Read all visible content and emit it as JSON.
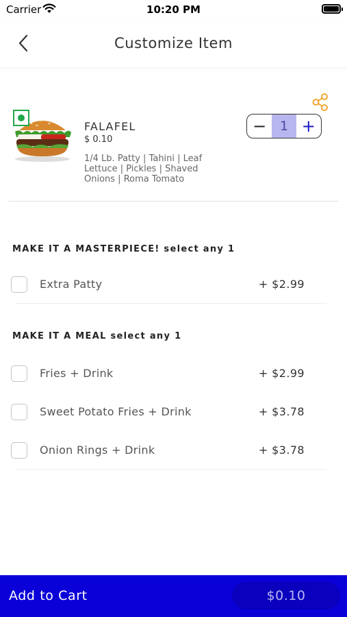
{
  "status_bar": {
    "carrier": "Carrier",
    "time": "10:20 PM",
    "icons": [
      "wifi-icon",
      "battery-icon"
    ]
  },
  "header": {
    "title": "Customize Item",
    "back_icon": "chevron-left-icon",
    "share_icon": "share-icon"
  },
  "item": {
    "name": "FALAFEL",
    "price": "$ 0.10",
    "description": "1/4 Lb. Patty | Tahini | Leaf Lettuce | Pickles | Shaved Onions | Roma Tomato",
    "veg_indicator_color": "#20a84a",
    "quantity": {
      "minus": "−",
      "value": "1",
      "plus": "+"
    }
  },
  "sections": [
    {
      "title": "MAKE IT A MASTERPIECE! select any 1",
      "options": [
        {
          "label": "Extra Patty",
          "price": "+  $2.99"
        }
      ]
    },
    {
      "title": "MAKE IT A MEAL select any 1",
      "options": [
        {
          "label": "Fries + Drink",
          "price": "+  $2.99"
        },
        {
          "label": "Sweet Potato Fries + Drink",
          "price": "+  $3.78"
        },
        {
          "label": "Onion Rings + Drink",
          "price": "+  $3.78"
        }
      ]
    }
  ],
  "footer": {
    "add_to_cart": "Add to Cart",
    "total": "$0.10",
    "colors": {
      "bar": "#0a00d8",
      "pill": "#0a00bd"
    }
  }
}
